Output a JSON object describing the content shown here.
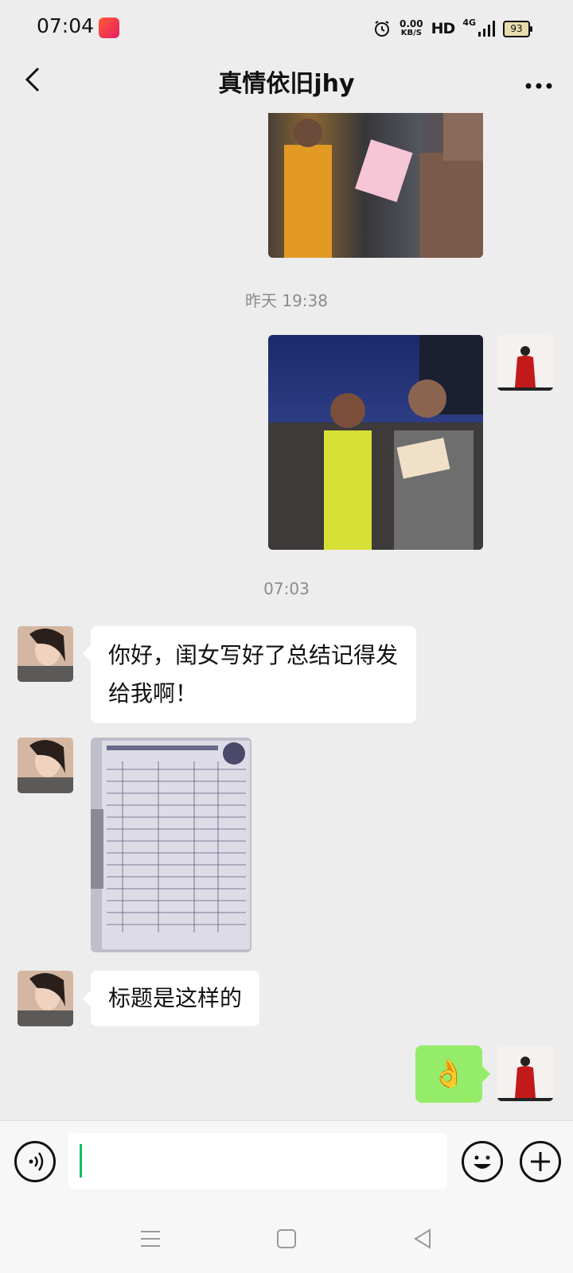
{
  "status": {
    "time": "07:04",
    "speed_value": "0.00",
    "speed_unit": "KB/S",
    "hd": "HD",
    "network": "4G",
    "battery": "93"
  },
  "nav": {
    "title": "真情依旧jhy",
    "back_icon": "chevron-left-icon",
    "more_icon": "more-icon"
  },
  "messages": {
    "stamp1": "昨天 19:38",
    "stamp2": "07:03",
    "text1": "你好，闺女写好了总结记得发给我啊！",
    "text2": "标题是这样的",
    "emoji": "👌"
  },
  "colors": {
    "bg": "#ededed",
    "bubble_green": "#95ec69",
    "caret": "#07c160"
  },
  "input": {
    "placeholder": ""
  }
}
